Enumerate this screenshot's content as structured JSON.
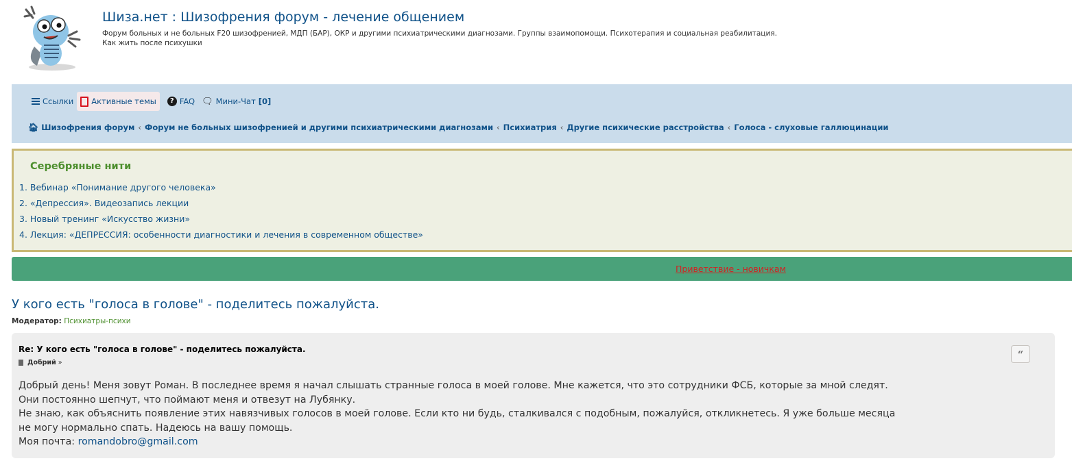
{
  "header": {
    "site_title": "Шиза.нет : Шизофрения форум - лечение общением",
    "site_description": "Форум больных и не больных F20 шизофренией, МДП (БАР), ОКР и другими психиатрическими диагнозами. Группы взаимопомощи. Психотерапия и социальная реабилитация.",
    "site_description_2": "Как жить после психушки"
  },
  "nav": {
    "links_label": "Ссылки",
    "active_topics_label": "Активные темы",
    "faq_label": "FAQ",
    "minichat_label": "Мини-Чат",
    "minichat_count": "[0]"
  },
  "breadcrumbs": [
    "Шизофрения форум",
    "Форум не больных шизофренией и другими психиатрическими диагнозами",
    "Психиатрия",
    "Другие психические расстройства",
    "Голоса - слуховые галлюцинации"
  ],
  "threads": {
    "title": "Серебряные нити",
    "items": [
      "1. Вебинар «Понимание другого человека»",
      "2. «Депрессия». Видеозапись лекции",
      "3. Новый тренинг «Искусство жизни»",
      "4. Лекция: «ДЕПРЕССИЯ: особенности диагностики и лечения в современном обществе»"
    ]
  },
  "welcome_link": "Приветствие - новичкам",
  "topic": {
    "title": "У кого есть \"голоса в голове\" - поделитесь пожалуйста.",
    "moderator_label": "Модератор:",
    "moderator_name": "Психиатры-психи"
  },
  "post": {
    "title": "Re: У кого есть \"голоса в голове\" - поделитесь пожалуйста.",
    "author": "Добрий",
    "author_suffix": "»",
    "quote_icon": "quote-icon",
    "body_line_1": "Добрый день! Меня зовут Роман. В последнее время я начал слышать странные голоса в моей голове. Мне кажется, что это сотрудники ФСБ, которые за мной следят.",
    "body_line_2": "Они постоянно шепчут, что поймают меня и отвезут на Лубянку.",
    "body_line_3": "Не знаю, как объяснить появление этих навязчивых голосов в моей голове. Если кто ни будь, сталкивался с подобным, пожалуйся, откликнетесь. Я уже больше месяца",
    "body_line_4": "не могу нормально спать. Надеюсь на вашу помощь.",
    "email_label": "Моя почта:",
    "email": "romandobro@gmail.com"
  },
  "colors": {
    "link": "#105289",
    "navbar_bg": "#cadceb",
    "threads_bg": "#eef0e3",
    "threads_border": "#c9b875",
    "threads_title": "#4d8f2e",
    "welcome_bg": "#4aa27a",
    "welcome_link": "#d22222",
    "post_bg": "#eeeeee"
  }
}
